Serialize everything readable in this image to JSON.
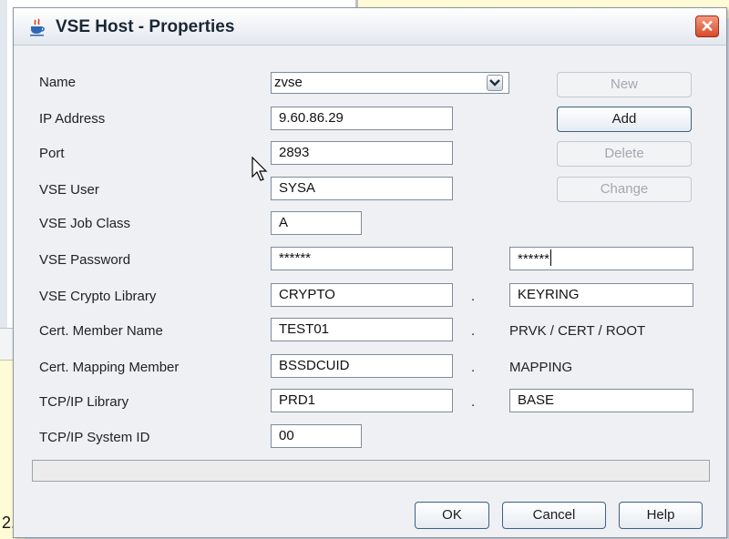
{
  "background": {
    "fragment_text": "2."
  },
  "dialog": {
    "title": "VSE Host - Properties",
    "close_label": "✕"
  },
  "form": {
    "name_label": "Name",
    "name_value": "zvse",
    "ip_label": "IP Address",
    "ip_value": "9.60.86.29",
    "port_label": "Port",
    "port_value": "2893",
    "user_label": "VSE User",
    "user_value": "SYSA",
    "jobclass_label": "VSE Job Class",
    "jobclass_value": "A",
    "password_label": "VSE Password",
    "password_value": "******",
    "password_confirm_value": "******",
    "crypto_label": "VSE Crypto Library",
    "crypto_library": "CRYPTO",
    "crypto_member": "KEYRING",
    "certmember_label": "Cert. Member Name",
    "certmember_value": "TEST01",
    "certmember_suffix": "PRVK / CERT / ROOT",
    "certmapping_label": "Cert. Mapping Member",
    "certmapping_value": "BSSDCUID",
    "certmapping_suffix": "MAPPING",
    "tcpiplib_label": "TCP/IP Library",
    "tcpiplib_library": "PRD1",
    "tcpiplib_member": "BASE",
    "tcpipid_label": "TCP/IP System ID",
    "tcpipid_value": "00",
    "separator": "."
  },
  "side_buttons": {
    "new": "New",
    "add": "Add",
    "delete": "Delete",
    "change": "Change"
  },
  "footer_buttons": {
    "ok": "OK",
    "cancel": "Cancel",
    "help": "Help"
  },
  "colors": {
    "accent_border": "#3f5f87",
    "close_button": "#d9492b",
    "background_note": "#fffbd6"
  }
}
